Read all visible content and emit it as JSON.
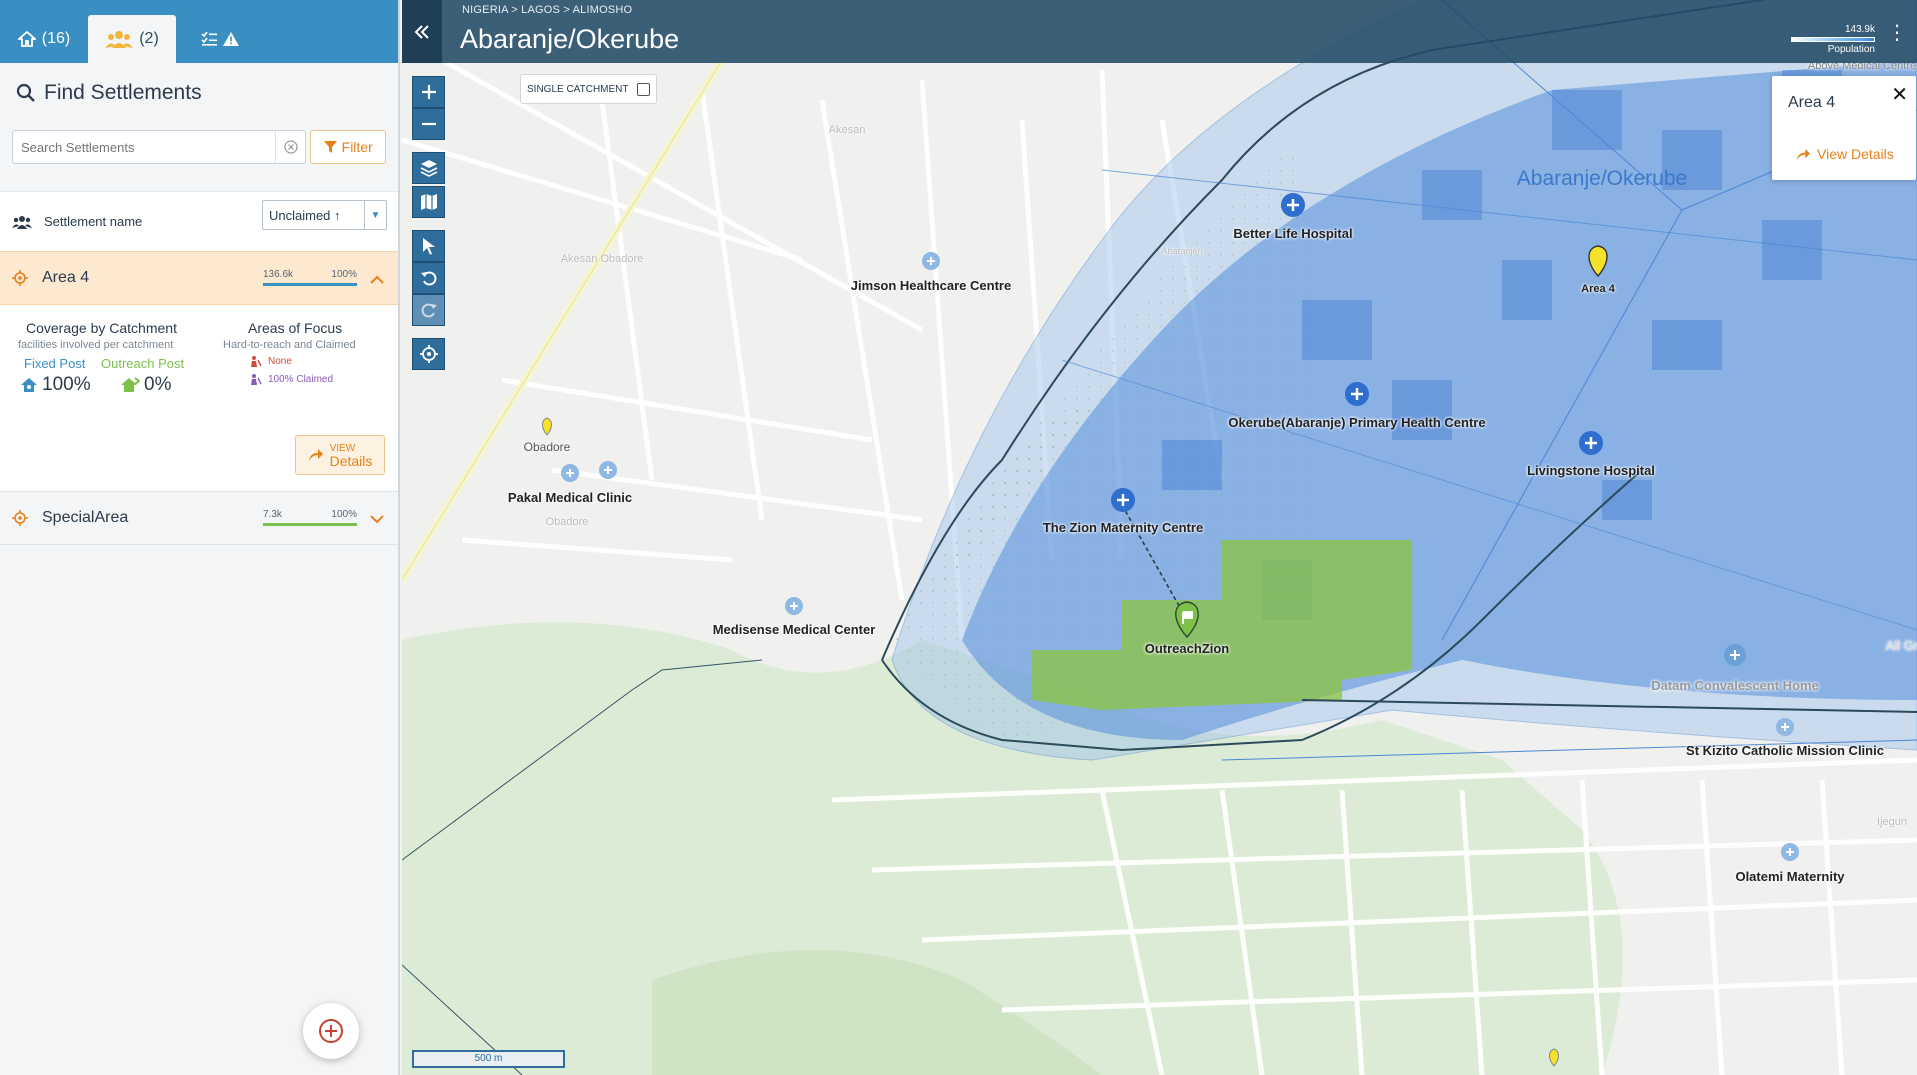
{
  "sidebar": {
    "tabs": [
      {
        "count": "(16)"
      },
      {
        "count": "(2)"
      },
      {
        "count": ""
      }
    ],
    "find_title": "Find Settlements",
    "search_placeholder": "Search Settlements",
    "filter_label": "Filter",
    "list_header_label": "Settlement name",
    "sort_value": "Unclaimed ↑",
    "settlements": [
      {
        "name": "Area 4",
        "population": "136.6k",
        "percent": "100%",
        "bar_color": "#3a8fc2"
      },
      {
        "name": "SpecialArea",
        "population": "7.3k",
        "percent": "100%",
        "bar_color": "#7dc04a"
      }
    ],
    "details": {
      "coverage_title": "Coverage by Catchment",
      "coverage_sub": "facilities involved per catchment",
      "fixed_label": "Fixed Post",
      "outreach_label": "Outreach Post",
      "fixed_value": "100%",
      "outreach_value": "0%",
      "focus_title": "Areas of Focus",
      "focus_sub": "Hard-to-reach and Claimed",
      "focus_none": "None",
      "focus_claimed": "100% Claimed",
      "view_small": "VIEW",
      "view_big": "Details"
    }
  },
  "map": {
    "breadcrumb": "NIGERIA  >  LAGOS  >  ALIMOSHO",
    "title": "Abaranje/Okerube",
    "population_value": "143.9k",
    "population_label": "Population",
    "single_catchment_label": "SINGLE CATCHMENT",
    "scale_label": "500 m",
    "popup": {
      "title": "Area 4",
      "view_label": "View Details"
    },
    "region_label": "Abaranje/Okerube",
    "labels": {
      "better_life": "Better Life Hospital",
      "jimson": "Jimson Healthcare Centre",
      "area4": "Area 4",
      "okerube": "Okerube(Abaranje) Primary Health Centre",
      "livingstone": "Livingstone Hospital",
      "obadore": "Obadore",
      "pakal": "Pakal Medical Clinic",
      "zion": "The Zion Maternity Centre",
      "medisense": "Medisense Medical Center",
      "outreach": "OutreachZion",
      "datam": "Datam Convalescent Home",
      "kizito": "St Kizito Catholic Mission Clinic",
      "olatemi": "Olatemi Maternity",
      "akesan": "Akesan Obadore",
      "obadore_small": "Obadore",
      "abaranjeh": "Abaranjeh",
      "akesan_top": "Akesan",
      "above_medical": "Above Medical Centre",
      "all_gr": "All Gr",
      "ijegun": "Ijegun"
    },
    "colors": {
      "catchment_blue": "#3d7fd9",
      "catchment_green": "#8cc63f",
      "accent": "#e8801a"
    }
  }
}
